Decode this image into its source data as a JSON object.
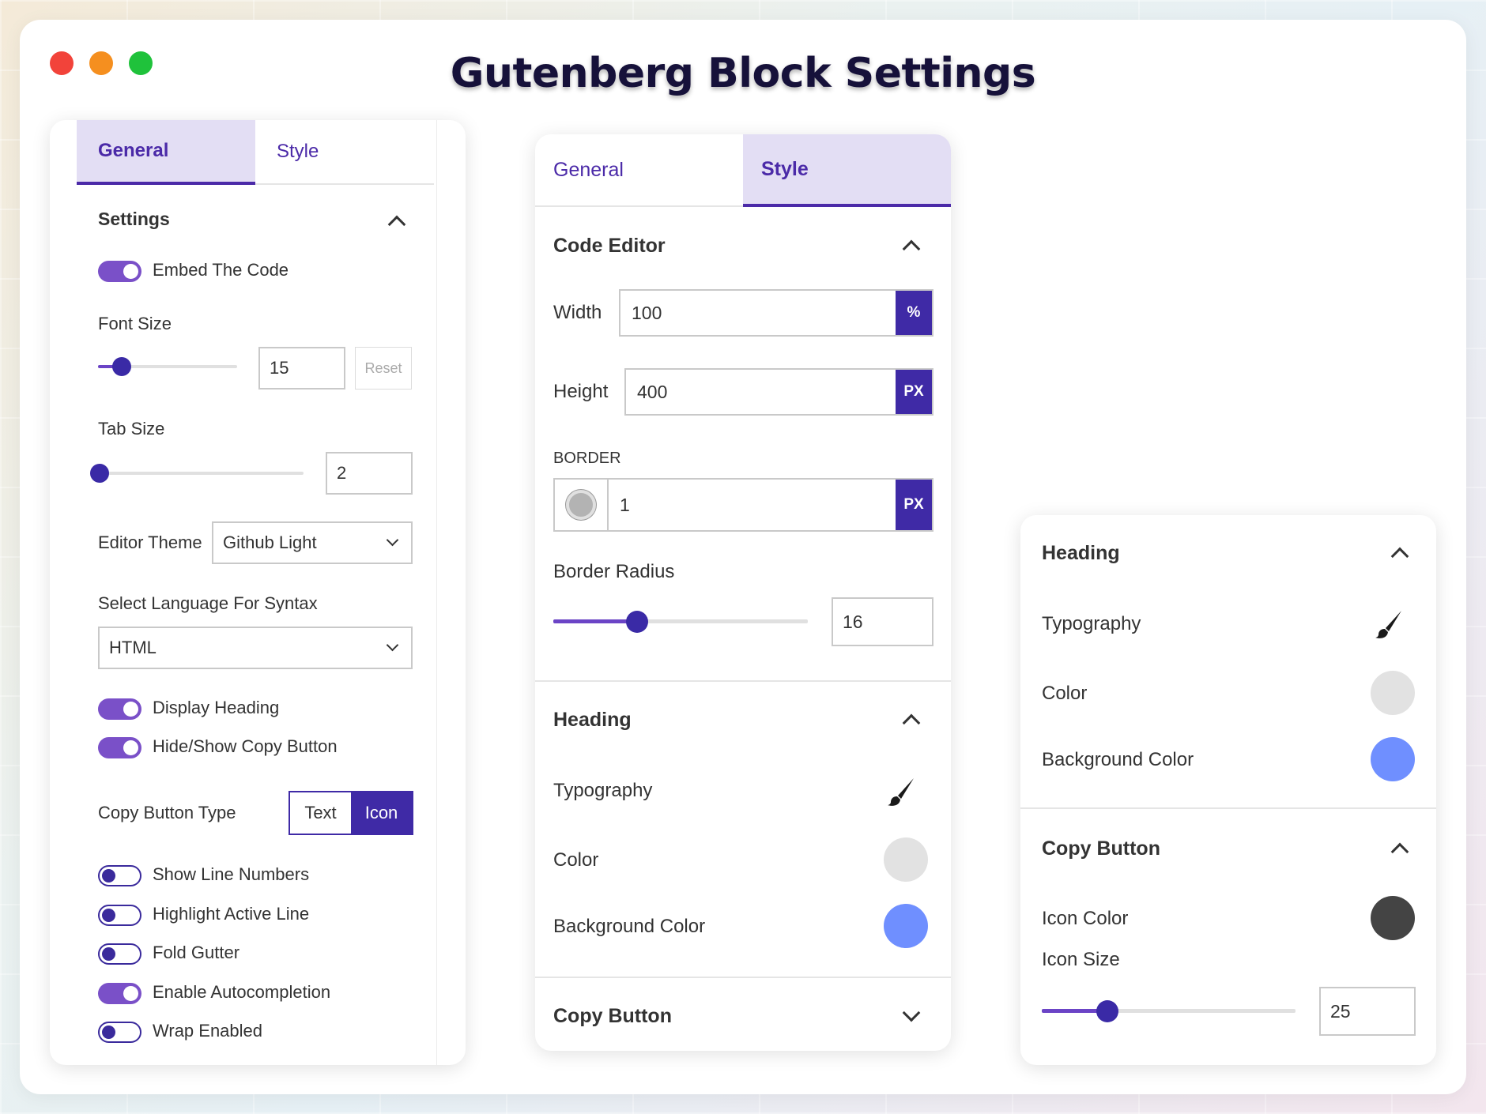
{
  "title": "Gutenberg Block Settings",
  "left_panel": {
    "tabs": [
      {
        "label": "General"
      },
      {
        "label": "Style"
      }
    ],
    "section_title": "Settings",
    "embed_code": {
      "label": "Embed The Code",
      "on": true
    },
    "font_size": {
      "label": "Font Size",
      "value": "15",
      "reset": "Reset"
    },
    "tab_size": {
      "label": "Tab Size",
      "value": "2"
    },
    "editor_theme": {
      "label": "Editor Theme",
      "value": "Github Light"
    },
    "language": {
      "label": "Select Language For Syntax",
      "value": "HTML"
    },
    "display_heading": {
      "label": "Display Heading",
      "on": true
    },
    "hide_copy": {
      "label": "Hide/Show Copy Button",
      "on": true
    },
    "copy_type": {
      "label": "Copy Button Type",
      "options": [
        "Text",
        "Icon"
      ],
      "selected": "Icon"
    },
    "line_numbers": {
      "label": "Show Line Numbers",
      "on": false
    },
    "highlight_line": {
      "label": "Highlight Active Line",
      "on": false
    },
    "fold_gutter": {
      "label": "Fold Gutter",
      "on": false
    },
    "autocompletion": {
      "label": "Enable Autocompletion",
      "on": true
    },
    "wrap": {
      "label": "Wrap Enabled",
      "on": false
    }
  },
  "middle_panel": {
    "tabs": [
      {
        "label": "General"
      },
      {
        "label": "Style"
      }
    ],
    "code_editor": {
      "title": "Code Editor",
      "width": {
        "label": "Width",
        "value": "100",
        "unit": "%"
      },
      "height": {
        "label": "Height",
        "value": "400",
        "unit": "PX"
      },
      "border": {
        "label": "BORDER",
        "value": "1",
        "unit": "PX"
      },
      "border_radius": {
        "label": "Border Radius",
        "value": "16"
      }
    },
    "heading": {
      "title": "Heading",
      "typography": "Typography",
      "color": "Color",
      "background_color": "Background Color"
    },
    "copy_button": {
      "title": "Copy Button"
    }
  },
  "right_panel": {
    "heading": {
      "title": "Heading",
      "typography": "Typography",
      "color": "Color",
      "background_color": "Background Color"
    },
    "copy_button": {
      "title": "Copy Button",
      "icon_color": "Icon Color",
      "icon_size": {
        "label": "Icon Size",
        "value": "25"
      }
    }
  },
  "colors": {
    "accent": "#3f2aa6",
    "toggle_on": "#7a50c8",
    "swatch_light": "#e2e2e2",
    "swatch_blue": "#6f8fff",
    "swatch_dark": "#444444"
  }
}
